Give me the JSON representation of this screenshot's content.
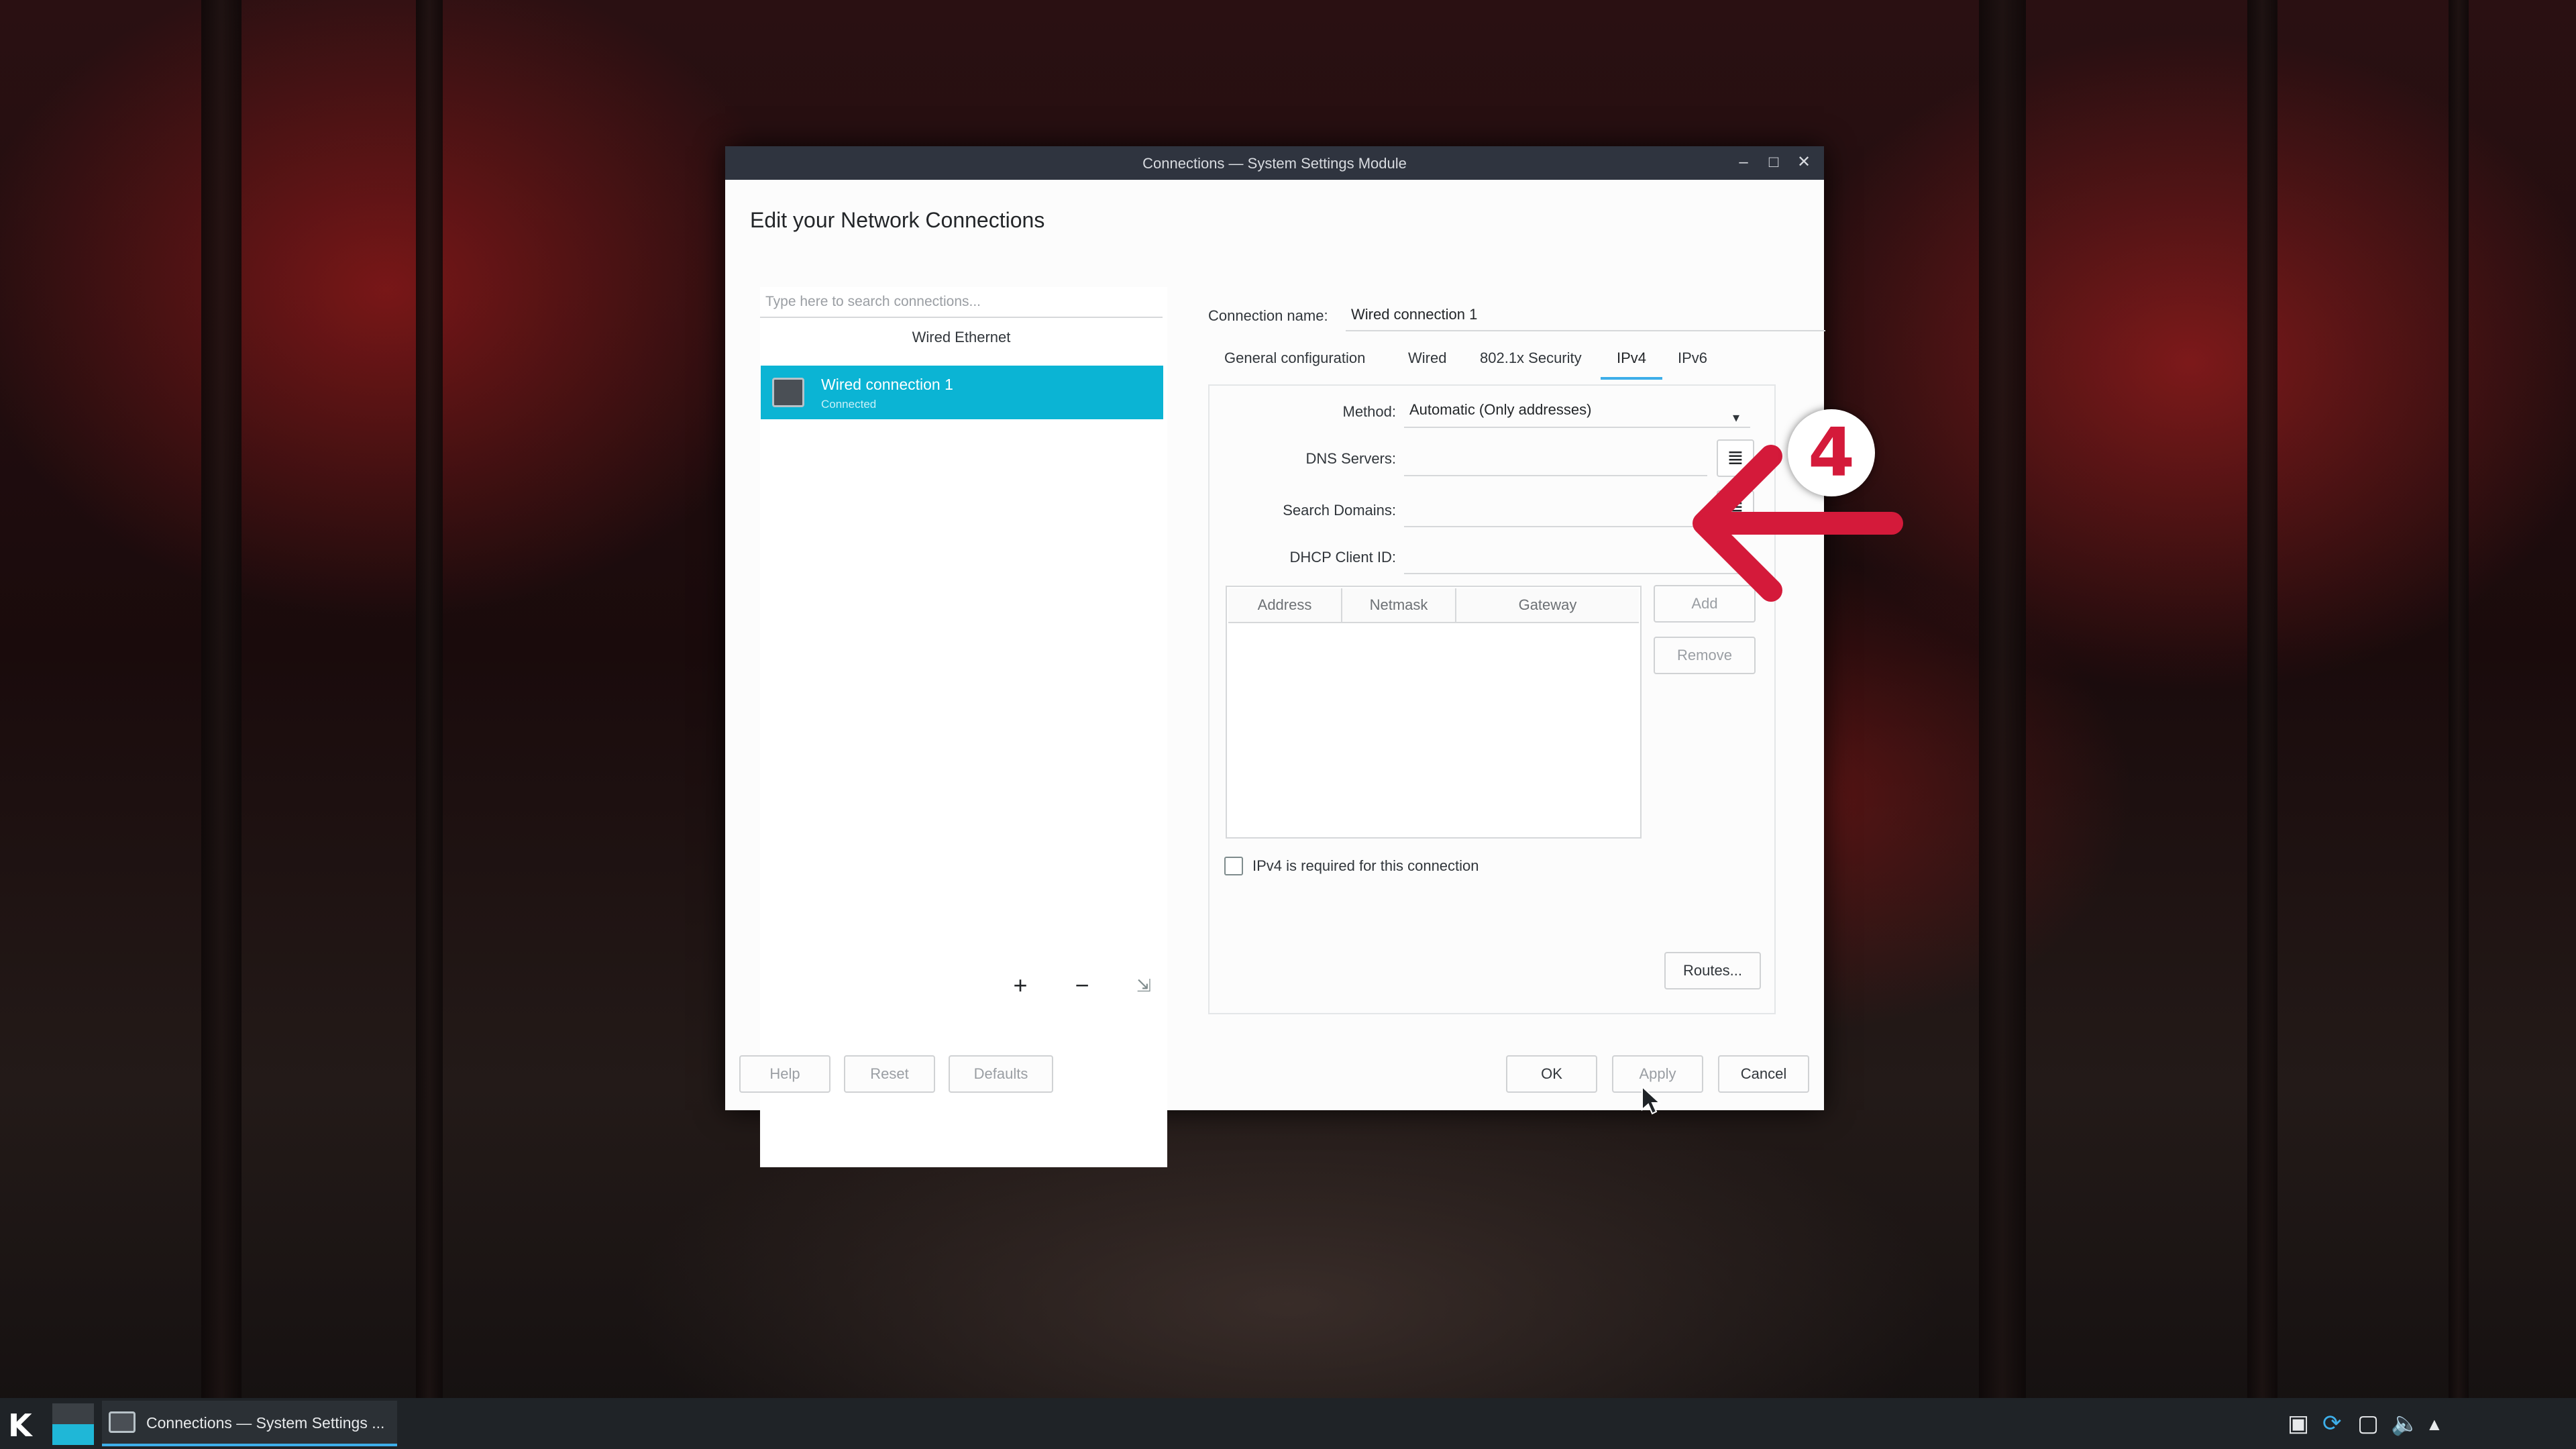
{
  "window": {
    "title": "Connections — System Settings Module",
    "heading": "Edit your Network Connections",
    "controls": {
      "minimize": "–",
      "maximize": "□",
      "close": "✕"
    }
  },
  "connections": {
    "search_placeholder": "Type here to search connections...",
    "group": "Wired Ethernet",
    "items": [
      {
        "name": "Wired connection 1",
        "status": "Connected"
      }
    ],
    "tools": {
      "add": "+",
      "remove": "−",
      "export": "⇲"
    }
  },
  "editor": {
    "connection_name_label": "Connection name:",
    "connection_name_value": "Wired connection 1",
    "tabs": [
      "General configuration",
      "Wired",
      "802.1x Security",
      "IPv4",
      "IPv6"
    ],
    "active_tab": "IPv4",
    "method_label": "Method:",
    "method_value": "Automatic (Only addresses)",
    "dns_label": "DNS Servers:",
    "dns_value": "",
    "search_domains_label": "Search Domains:",
    "search_domains_value": "",
    "dhcp_label": "DHCP Client ID:",
    "dhcp_value": "",
    "table_headers": [
      "Address",
      "Netmask",
      "Gateway"
    ],
    "add_label": "Add",
    "remove_label": "Remove",
    "required_label": "IPv4 is required for this connection",
    "routes_label": "Routes..."
  },
  "footer": {
    "help": "Help",
    "reset": "Reset",
    "defaults": "Defaults",
    "ok": "OK",
    "apply": "Apply",
    "cancel": "Cancel"
  },
  "annotation": {
    "step": "4",
    "color": "#d41a3a"
  },
  "taskbar": {
    "launcher": "K",
    "task_label": "Connections — System Settings ...",
    "accent": "#3daee9"
  }
}
